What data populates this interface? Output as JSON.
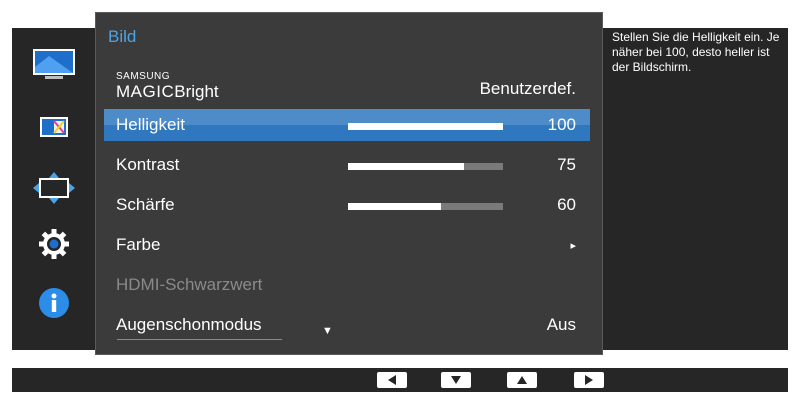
{
  "menu": {
    "title": "Bild",
    "magic_bright": {
      "brand_small": "SAMSUNG",
      "brand_large": "MAGIC",
      "name": "Bright",
      "value": "Benutzerdef."
    },
    "items": [
      {
        "label": "Helligkeit",
        "value": "100",
        "level": 1.0,
        "selected": true
      },
      {
        "label": "Kontrast",
        "value": "75",
        "level": 0.75
      },
      {
        "label": "Schärfe",
        "value": "60",
        "level": 0.6
      },
      {
        "label": "Farbe",
        "value": "▸"
      },
      {
        "label": "HDMI-Schwarzwert",
        "disabled": true
      },
      {
        "label": "Augenschonmodus",
        "value": "Aus"
      }
    ],
    "scroll_arrow": "▼"
  },
  "help_text": "Stellen Sie die Helligkeit ein. Je näher bei 100, desto heller ist der Bildschirm.",
  "sidebar_icons": [
    "picture-icon",
    "color-icon",
    "size-position-icon",
    "settings-icon",
    "info-icon"
  ],
  "nav_buttons": [
    "left-arrow-icon",
    "down-arrow-icon",
    "up-arrow-icon",
    "right-arrow-icon"
  ],
  "colors": {
    "accent": "#4ba3e8",
    "selected_row": "#2f78c0",
    "menu_bg": "#3b3b3b",
    "panel_bg": "#262626"
  }
}
